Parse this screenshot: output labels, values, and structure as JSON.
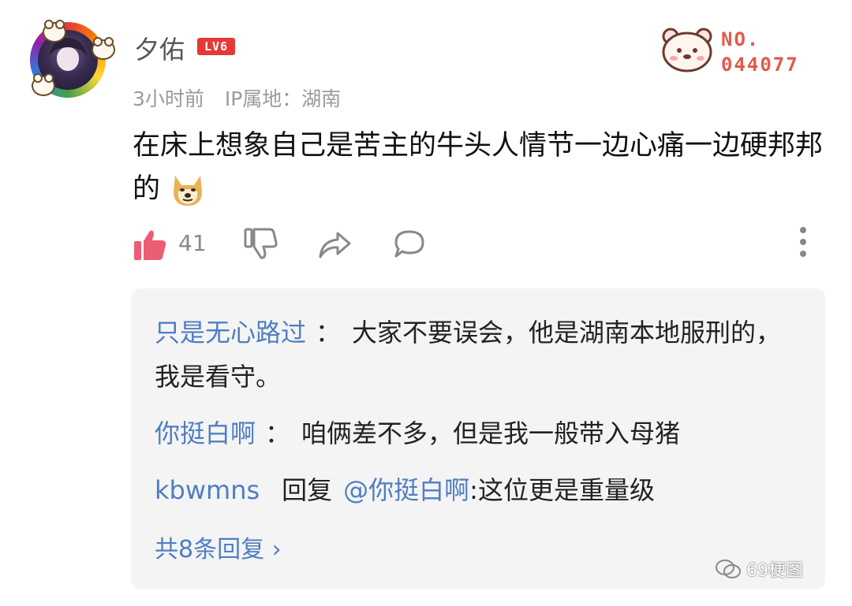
{
  "author": {
    "name": "夕佑",
    "level_badge": "LV6",
    "time": "3小时前",
    "ip_location": "IP属地：湖南"
  },
  "number_badge": {
    "label": "NO.",
    "number": "044077"
  },
  "comment": {
    "text": "在床上想象自己是苦主的牛头人情节一边心痛一边硬邦邦的",
    "emoji": "doge-emoji"
  },
  "actions": {
    "like_count": "41",
    "like_color": "#ec5c75",
    "icon_color": "#888888"
  },
  "replies": [
    {
      "user": "只是无心路过",
      "colon": "：",
      "text": "大家不要误会，他是湖南本地服刑的，我是看守。"
    },
    {
      "user": "你挺白啊",
      "colon": "：",
      "text": "咱俩差不多，但是我一般带入母猪"
    },
    {
      "user": "kbwmns",
      "reply_word": "回复",
      "mention": "@你挺白啊",
      "text": ":这位更是重量级"
    }
  ],
  "total_replies": "共8条回复 ›",
  "watermark": "69梗图",
  "link_color": "#4f7ec2"
}
